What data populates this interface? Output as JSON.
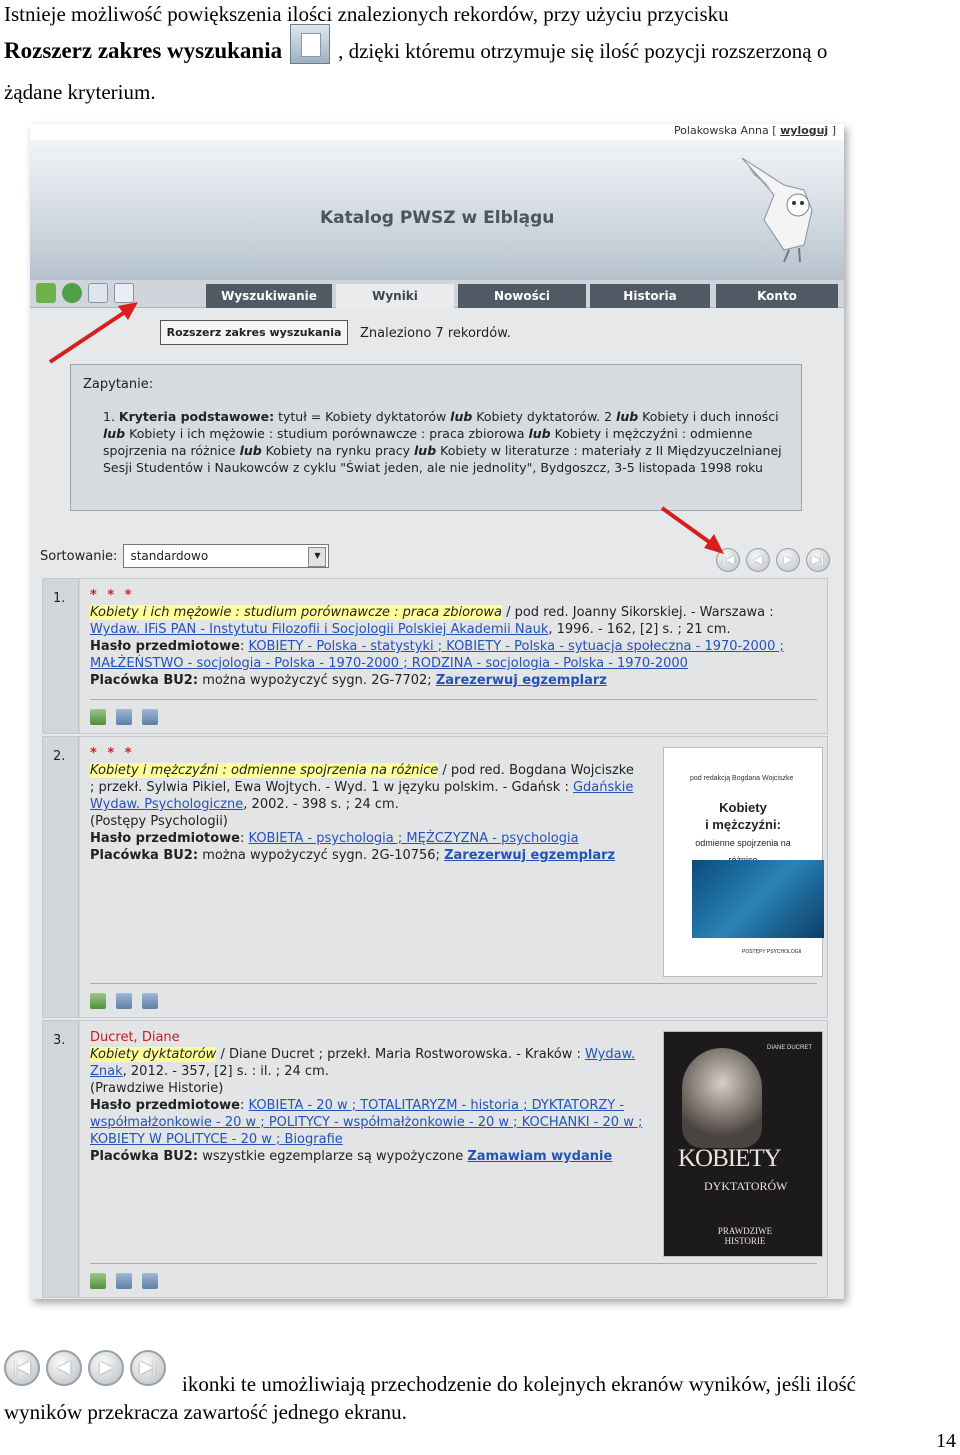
{
  "doc": {
    "line1": "Istnieje możliwość powiększenia ilości znalezionych rekordów, przy użyciu przycisku",
    "line2_bold": "Rozszerz zakres wyszukania",
    "line2_rest": ", dzięki któremu otrzymuje się ilość pozycji rozszerzoną o",
    "line3": "żądane kryterium.",
    "footer_line1": "ikonki te umożliwiają przechodzenie do kolejnych ekranów wyników, jeśli ilość",
    "footer_line2": "wyników przekracza zawartość jednego ekranu.",
    "page_number": "14"
  },
  "shot": {
    "user": "Polakowska Anna",
    "logout": "wyloguj",
    "title": "Katalog PWSZ w Elblągu",
    "tabs": [
      "Wyszukiwanie",
      "Wyniki",
      "Nowości",
      "Historia",
      "Konto"
    ],
    "expand_button": "Rozszerz zakres wyszukania",
    "found": "Znaleziono 7 rekordów.",
    "query_label": "Zapytanie:",
    "query_num": "1.",
    "query_b1": "Kryteria podstawowe:",
    "query_t1": " tytuł = Kobiety dyktatorów ",
    "query_lub": "lub",
    "query_t2": " Kobiety dyktatorów. 2 ",
    "query_t3": " Kobiety i duch inności ",
    "query_t4": " Kobiety i ich mężowie : studium porównawcze : praca zbiorowa ",
    "query_t5": " Kobiety i mężczyźni : odmienne spojrzenia na różnice ",
    "query_t6": " Kobiety na rynku pracy ",
    "query_t7": " Kobiety w literaturze : materiały z II Międzyuczelnianej Sesji Studentów i Naukowców z cyklu \"Świat jeden, ale nie jednolity\", Bydgoszcz, 3-5 listopada 1998 roku",
    "sort_label": "Sortowanie:",
    "sort_value": "standardowo",
    "records": [
      {
        "num": "1.",
        "stars": "* * *",
        "title": "Kobiety i ich mężowie : studium porównawcze : praca zbiorowa",
        "rest": " / pod red. Joanny Sikorskiej. - Warszawa :",
        "pub_link": "Wydaw. IFiS PAN - Instytutu Filozofii i Socjologii Polskiej Akademii Nauk",
        "pub_rest": ", 1996. - 162, [2] s. ; 21 cm.",
        "subj_label": "Hasło przedmiotowe",
        "subjects": "KOBIETY - Polska - statystyki ; KOBIETY - Polska - sytuacja społeczna - 1970-2000 ; MAŁŻEŃSTWO - socjologia - Polska - 1970-2000 ; RODZINA - socjologia - Polska - 1970-2000",
        "loc_label": "Placówka BU2:",
        "loc_text": " można wypożyczyć sygn. 2G-7702; ",
        "loc_link": "Zarezerwuj egzemplarz"
      },
      {
        "num": "2.",
        "stars": "* * *",
        "title": "Kobiety i mężczyźni : odmienne spojrzenia na różnice",
        "rest": " / pod red. Bogdana Wojciszke ; przekł. Sylwia Pikiel, Ewa Wojtych. - Wyd. 1 w języku polskim. - Gdańsk : ",
        "pub_link": "Gdańskie Wydaw. Psychologiczne",
        "pub_rest": ", 2002. - 398 s. ; 24 cm.",
        "series": "(Postępy Psychologii)",
        "subj_label": "Hasło przedmiotowe",
        "subjects": "KOBIETA - psychologia ; MĘŻCZYZNA - psychologia",
        "loc_label": "Placówka BU2:",
        "loc_text": " można wypożyczyć sygn. 2G-10756; ",
        "loc_link": "Zarezerwuj egzemplarz",
        "cover_editor": "pod redakcją Bogdana Wojciszke",
        "cover_title1": "Kobiety",
        "cover_title2": "i mężczyźni:",
        "cover_sub": "odmienne spojrzenia na różnice",
        "cover_series": "POSTĘPY PSYCHOLOGII"
      },
      {
        "num": "3.",
        "author": "Ducret, Diane",
        "title": "Kobiety dyktatorów",
        "rest": " / Diane Ducret ; przekł. Maria Rostworowska. - Kraków : ",
        "pub_link": "Wydaw. Znak",
        "pub_rest": ", 2012. - 357, [2] s. : il. ; 24 cm.",
        "series": "(Prawdziwe Historie)",
        "subj_label": "Hasło przedmiotowe",
        "subjects": "KOBIETA - 20 w ; TOTALITARYZM - historia ; DYKTATORZY - współmałżonkowie - 20 w ; POLITYCY - współmałżonkowie - 20 w ; KOCHANKI - 20 w ; KOBIETY W POLITYCE - 20 w ; Biografie",
        "loc_label": "Placówka BU2:",
        "loc_text": " wszystkie egzemplarze są wypożyczone ",
        "loc_link": "Zamawiam wydanie",
        "cover_author": "DIANE DUCRET",
        "cover_title1": "KOBIETY",
        "cover_title2": "DYKTATORÓW",
        "cover_sub": "PRAWDZIWE HISTORIE"
      }
    ]
  },
  "colors": {
    "nav_tab": "#505a64",
    "link": "#2552b8",
    "highlight": "#ffff99",
    "arrow": "#d81e1e"
  }
}
